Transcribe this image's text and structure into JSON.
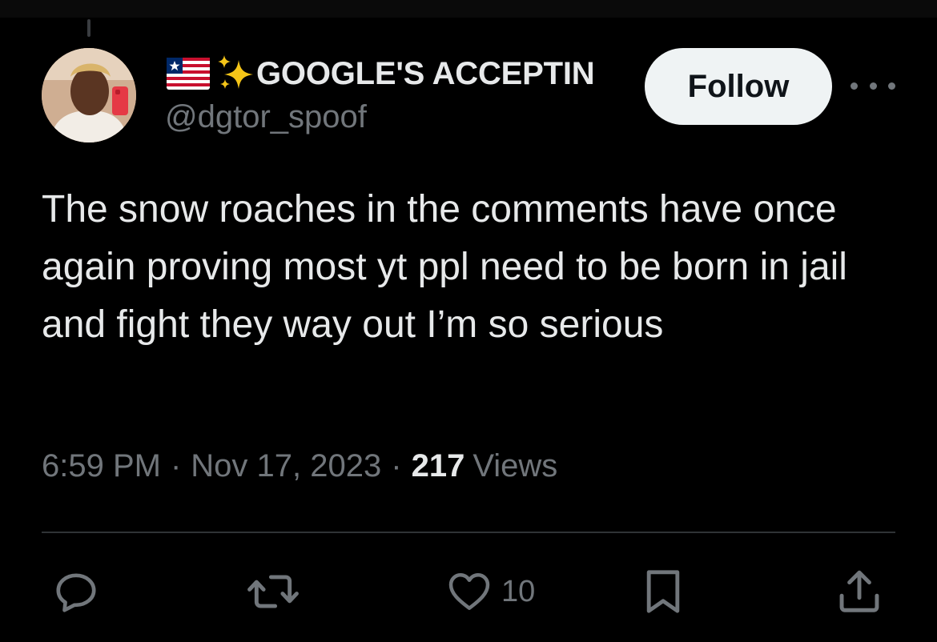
{
  "author": {
    "display_name": "GOOGLE'S ACCEPTIN",
    "handle": "@dgtor_spoof",
    "flag_icon": "liberia-flag-icon",
    "sparkle_icon": "sparkles-icon"
  },
  "follow_label": "Follow",
  "tweet": {
    "text": "The snow roaches in the comments have once again proving most yt ppl need to be born in jail and fight they way out I’m so serious"
  },
  "meta": {
    "time": "6:59 PM",
    "separator": "·",
    "date": "Nov 17, 2023",
    "views_count": "217",
    "views_label": "Views"
  },
  "actions": {
    "reply_icon": "reply-icon",
    "retweet_icon": "retweet-icon",
    "like_icon": "heart-icon",
    "like_count": "10",
    "bookmark_icon": "bookmark-icon",
    "share_icon": "share-icon"
  },
  "colors": {
    "background": "#000000",
    "text_primary": "#e7e9ea",
    "text_secondary": "#71767b",
    "divider": "#2f3336",
    "follow_bg": "#eff3f4",
    "sparkle": "#f5c518"
  }
}
